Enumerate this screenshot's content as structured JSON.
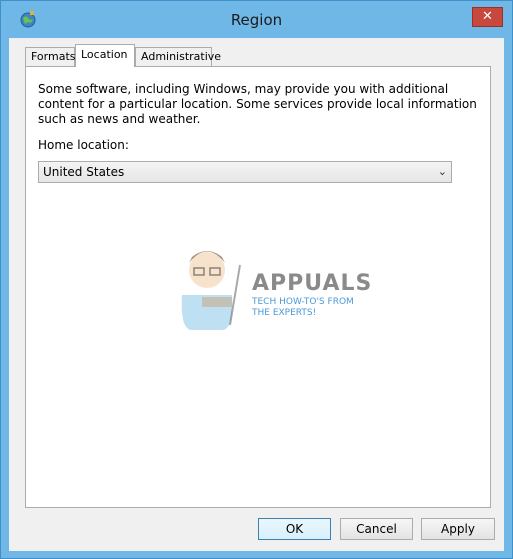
{
  "window": {
    "title": "Region",
    "close_glyph": "✕"
  },
  "tabs": [
    {
      "label": "Formats"
    },
    {
      "label": "Location"
    },
    {
      "label": "Administrative"
    }
  ],
  "location": {
    "description": "Some software, including Windows, may provide you with additional content for a particular location. Some services provide local information such as news and weather.",
    "home_label": "Home location:",
    "selected": "United States"
  },
  "watermark": {
    "title": "APPUALS",
    "subtitle": "TECH HOW-TO'S FROM THE EXPERTS!"
  },
  "buttons": {
    "ok": "OK",
    "cancel": "Cancel",
    "apply": "Apply"
  }
}
